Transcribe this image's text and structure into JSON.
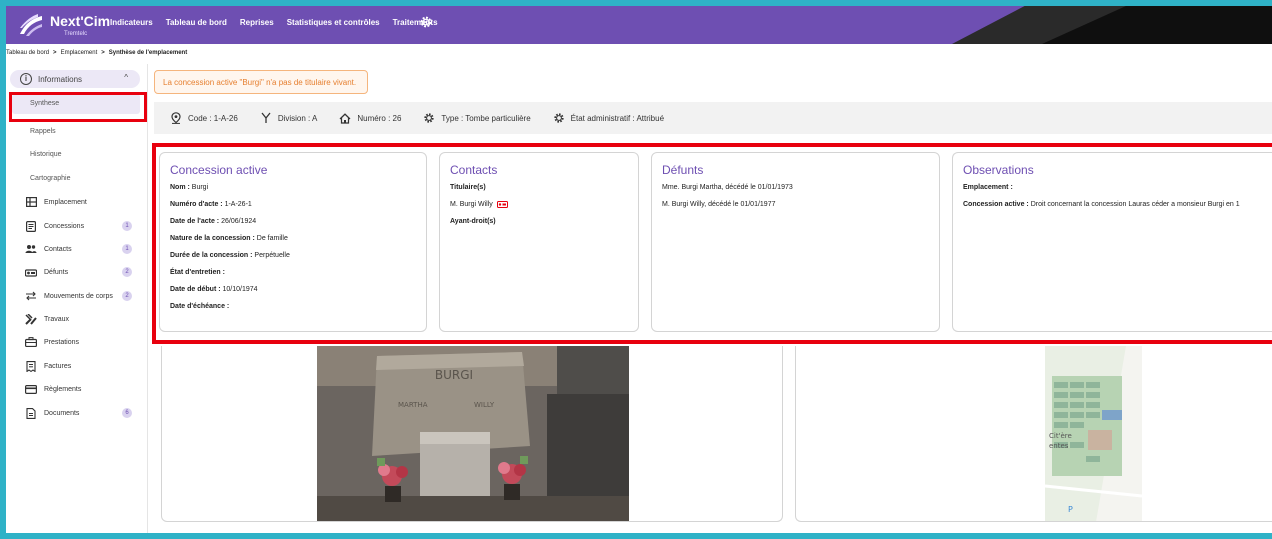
{
  "app": {
    "brand": "Next'Cim",
    "brand_sub": "Tremtelc"
  },
  "nav": {
    "items": [
      "Indicateurs",
      "Tableau de bord",
      "Reprises",
      "Statistiques et contrôles",
      "Traitements"
    ],
    "settings_icon": "gear-icon"
  },
  "breadcrumb": {
    "items": [
      "Tableau de bord",
      "Emplacement",
      "Synthèse de l'emplacement"
    ],
    "separator": ">"
  },
  "sidebar": {
    "section": {
      "label": "Informations",
      "icon": "info-icon"
    },
    "sub_items": [
      "Synthese",
      "Rappels",
      "Historique",
      "Cartographie"
    ],
    "items": [
      {
        "label": "Emplacement",
        "icon": "grid-icon",
        "badge": ""
      },
      {
        "label": "Concessions",
        "icon": "document-icon",
        "badge": "1"
      },
      {
        "label": "Contacts",
        "icon": "people-icon",
        "badge": "1"
      },
      {
        "label": "Défunts",
        "icon": "deceased-icon",
        "badge": "2"
      },
      {
        "label": "Mouvements de corps",
        "icon": "swap-icon",
        "badge": "2"
      },
      {
        "label": "Travaux",
        "icon": "tools-icon",
        "badge": ""
      },
      {
        "label": "Prestations",
        "icon": "briefcase-icon",
        "badge": ""
      },
      {
        "label": "Factures",
        "icon": "invoice-icon",
        "badge": ""
      },
      {
        "label": "Règlements",
        "icon": "card-icon",
        "badge": ""
      },
      {
        "label": "Documents",
        "icon": "file-icon",
        "badge": "6"
      }
    ]
  },
  "alert": {
    "text": "La concession active \"Burgi\" n'a pas de titulaire vivant."
  },
  "infobar": {
    "code": "Code : 1-A-26",
    "division": "Division : A",
    "numero": "Numéro : 26",
    "type": "Type : Tombe particulière",
    "etat": "État administratif : Attribué"
  },
  "concession": {
    "title": "Concession active",
    "nom_label": "Nom :",
    "nom_value": " Burgi",
    "acte_label": "Numéro d'acte :",
    "acte_value": " 1-A-26-1",
    "date_acte_label": "Date de l'acte :",
    "date_acte_value": " 26/06/1924",
    "nature_label": "Nature de la concession :",
    "nature_value": " De famille",
    "duree_label": "Durée de la concession :",
    "duree_value": " Perpétuelle",
    "entretien_label": "État d'entretien :",
    "debut_label": "Date de début :",
    "debut_value": " 10/10/1974",
    "echeance_label": "Date d'échéance :"
  },
  "contacts": {
    "title": "Contacts",
    "titulaire_label": "Titulaire(s)",
    "titulaire_name": "M. Burgi Willy",
    "ayant_droit_label": "Ayant-droit(s)"
  },
  "defunts": {
    "title": "Défunts",
    "items": [
      "Mme. Burgi Martha, décédé le 01/01/1973",
      "M. Burgi Willy, décédé le 01/01/1977"
    ]
  },
  "observations": {
    "title": "Observations",
    "emplacement_label": "Emplacement :",
    "concession_label": "Concession active :",
    "concession_text": " Droit concernant la concession Lauras céder a monsieur Burgi en 1"
  },
  "photo": {
    "stone_name": "BURGI",
    "left_name": "MARTHA",
    "right_name": "WILLY"
  },
  "map": {
    "label_1": "Cit'ère",
    "label_2": "entes",
    "label_3": "P"
  },
  "colors": {
    "accent": "#6e4fb2",
    "highlight": "#e8000e",
    "warning": "#e67f2f",
    "frame": "#2fb2c7"
  }
}
